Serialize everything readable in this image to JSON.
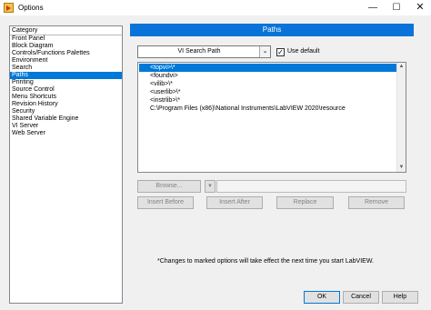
{
  "window": {
    "title": "Options",
    "minimize_glyph": "—",
    "maximize_glyph": "☐",
    "close_glyph": "✕"
  },
  "category": {
    "header": "Category",
    "items": [
      "Front Panel",
      "Block Diagram",
      "Controls/Functions Palettes",
      "Environment",
      "Search",
      "Paths",
      "Printing",
      "Source Control",
      "Menu Shortcuts",
      "Revision History",
      "Security",
      "Shared Variable Engine",
      "VI Server",
      "Web Server"
    ],
    "selected": "Paths"
  },
  "main": {
    "section_title": "Paths",
    "path_type": "VI Search Path",
    "dropdown_arrow": "⌄",
    "use_default_label": "Use default",
    "use_default_checked": true,
    "check_glyph": "✓",
    "paths": [
      "<topvi>\\*",
      "<foundvi>",
      "<vilib>\\*",
      "<userlib>\\*",
      "<instrlib>\\*",
      "C:\\Program Files (x86)\\National Instruments\\LabVIEW 2020\\resource"
    ],
    "selected_path": "<topvi>\\*",
    "scroll_up": "▲",
    "scroll_down": "▼",
    "browse_label": "Browse...",
    "browse_arrow": "▼",
    "path_value": "",
    "insert_before_label": "Insert Before",
    "insert_after_label": "Insert After",
    "replace_label": "Replace",
    "remove_label": "Remove",
    "note": "*Changes to marked options will take effect the next time you start LabVIEW."
  },
  "footer": {
    "ok_label": "OK",
    "cancel_label": "Cancel",
    "help_label": "Help"
  }
}
